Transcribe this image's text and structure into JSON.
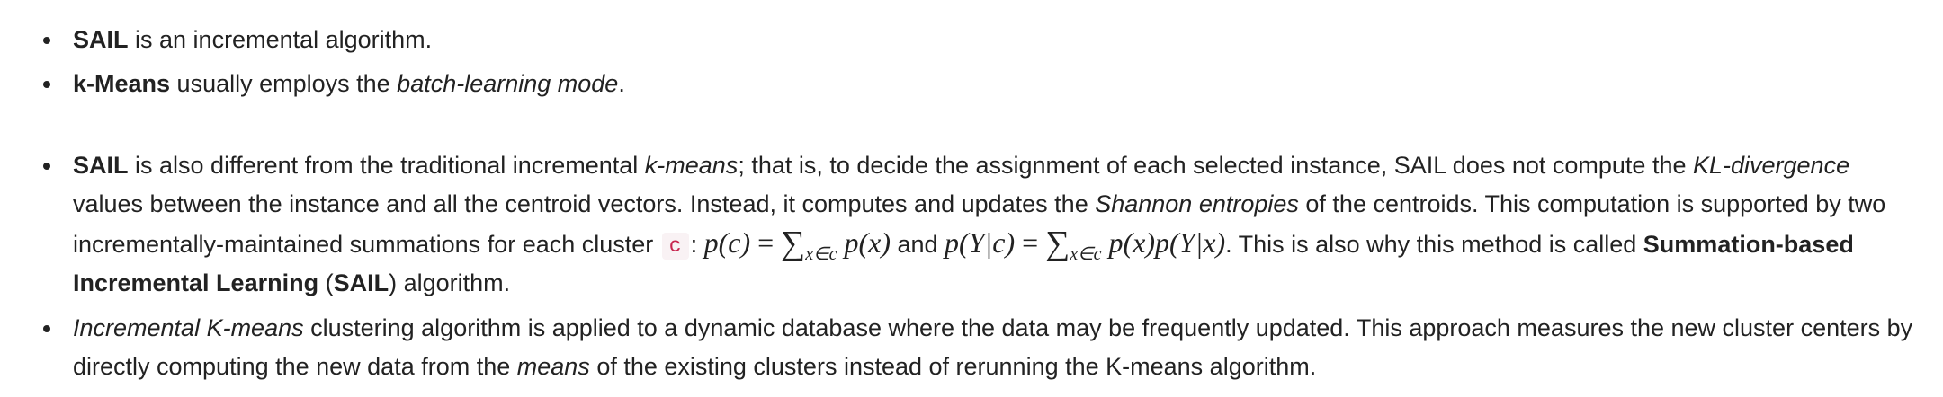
{
  "list_top": {
    "items": [
      {
        "bold": "SAIL",
        "text": " is an incremental algorithm."
      },
      {
        "bold": "k-Means",
        "text": " usually employs the ",
        "italic": "batch-learning mode",
        "end": "."
      }
    ]
  },
  "item_sail": {
    "bold_lead": "SAIL",
    "t1": " is also different from the traditional incremental ",
    "i1": "k-means",
    "t2": "; that is, to decide the assignment of each selected instance, SAIL does not compute the ",
    "i2": "KL-divergence",
    "t3": " values between the instance and all the centroid vectors. Instead, it computes and updates the ",
    "i3": "Shannon entropies",
    "t4": " of the centroids. This computation is supported by two incrementally-maintained summations for each cluster ",
    "code": "c",
    "t5": ": ",
    "formula_1": {
      "lhs": "p(c)",
      "eq": "=",
      "sigma": "∑",
      "sub": "x∈c",
      "rhs": "p(x)"
    },
    "t6": " and ",
    "formula_2": {
      "lhs": "p(Y|c)",
      "eq": "=",
      "sigma": "∑",
      "sub": "x∈c",
      "rhs": "p(x)p(Y|x)"
    },
    "t7": ". This is also why this method is called ",
    "b2": "Summation-based Incremental Learning",
    "t8": " (",
    "b3": "SAIL",
    "t9": ") algorithm."
  },
  "item_incremental": {
    "i1": "Incremental K-means",
    "t1": " clustering algorithm is applied to a dynamic database where the data may be frequently updated. This approach measures the new cluster centers by directly computing the new data from the ",
    "i2": "means",
    "t2": " of the existing clusters instead of rerunning the K-means algorithm."
  }
}
